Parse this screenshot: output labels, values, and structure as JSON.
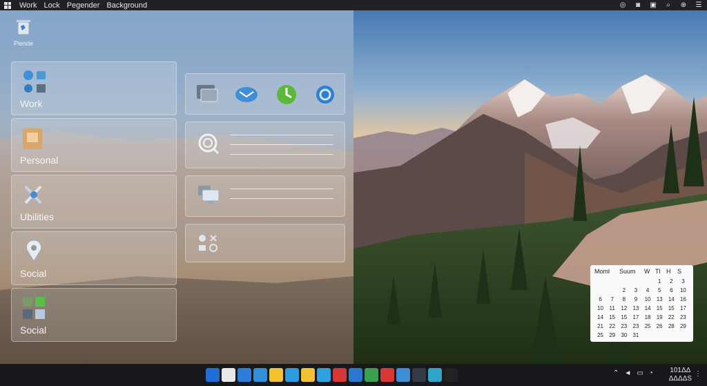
{
  "topbar": {
    "menu": [
      "Work",
      "Lock",
      "Pegender",
      "Background"
    ]
  },
  "desktop": {
    "icon_label": "Plende"
  },
  "tiles": [
    {
      "label": "Work"
    },
    {
      "label": "Personal"
    },
    {
      "label": "Ubilities"
    },
    {
      "label": "Social"
    },
    {
      "label": "Social"
    }
  ],
  "calendar": {
    "headers": [
      "Moml",
      "Suum",
      "W",
      "Tl",
      "H",
      "S"
    ],
    "rows": [
      [
        "",
        "",
        "",
        "",
        "",
        "1",
        "2",
        "3"
      ],
      [
        "",
        "",
        "2",
        "3",
        "4",
        "5",
        "6",
        "10"
      ],
      [
        "6",
        "7",
        "8",
        "9",
        "10",
        "13",
        "14",
        "16"
      ],
      [
        "10",
        "11",
        "12",
        "13",
        "14",
        "15",
        "15",
        "17"
      ],
      [
        "14",
        "15",
        "15",
        "17",
        "18",
        "19",
        "22",
        "23"
      ],
      [
        "21",
        "22",
        "23",
        "23",
        "25",
        "26",
        "28",
        "29"
      ],
      [
        "25",
        "29",
        "30",
        "31",
        "",
        "",
        "",
        ""
      ]
    ]
  },
  "taskbar": {
    "clock_time": "101ΔΔ",
    "clock_date": "ΔΔΔΔS",
    "icon_colors": [
      "#1d6fd6",
      "#e8e8e8",
      "#2b7fd9",
      "#2f8fd8",
      "#f2c230",
      "#2c9be0",
      "#f2c230",
      "#2fa0e0",
      "#d93636",
      "#2b78d0",
      "#3aa050",
      "#d93636",
      "#3b8ed6",
      "#333a44",
      "#2fa6c9",
      "#222222"
    ]
  },
  "colors": {
    "taskbar": "#16181c",
    "topbar": "#1f2126"
  }
}
